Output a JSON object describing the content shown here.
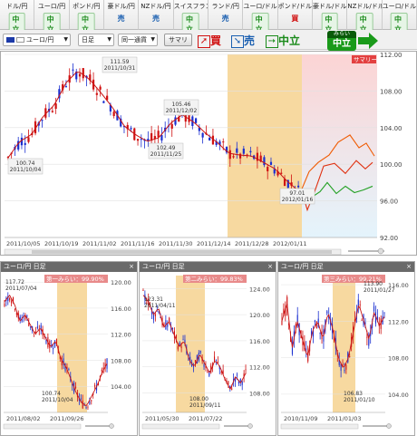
{
  "tabs": [
    {
      "name": "ドル/円",
      "signal": "中立",
      "type": "chu"
    },
    {
      "name": "ユーロ/円",
      "signal": "中立",
      "type": "chu"
    },
    {
      "name": "ポンド/円",
      "signal": "中立",
      "type": "chu"
    },
    {
      "name": "豪ドル/円",
      "signal": "売",
      "type": "uri"
    },
    {
      "name": "NZドル/円",
      "signal": "売",
      "type": "uri"
    },
    {
      "name": "スイスフラン/円",
      "signal": "中立",
      "type": "chu"
    },
    {
      "name": "ランド/円",
      "signal": "売",
      "type": "uri"
    },
    {
      "name": "ユーロ/ドル",
      "signal": "中立",
      "type": "chu"
    },
    {
      "name": "ポンド/ドル",
      "signal": "買",
      "type": "kai"
    },
    {
      "name": "豪ドル/ドル",
      "signal": "中立",
      "type": "chu"
    },
    {
      "name": "NZドル/ドル",
      "signal": "中立",
      "type": "chu"
    },
    {
      "name": "ユーロ/ドル",
      "signal": "中立",
      "type": "chu"
    }
  ],
  "toolbar": {
    "pair": "ユーロ/円",
    "period": "日足",
    "mode": "同一通貨",
    "summary_btn": "サマリ",
    "buy": "買",
    "sell": "売",
    "neutral": "中立",
    "mirai_label": "みらい",
    "mirai_signal": "中立"
  },
  "colors": {
    "up": "#d01010",
    "down": "#1a2fd0",
    "ma": "#c81414",
    "highlight": "#f7d9a0",
    "forecast_bg": "#fbe0e0",
    "forecast_bg2": "#e6f4fb",
    "green": "#22a022",
    "orange": "#f05a00"
  },
  "main": {
    "summary_tag": "サマリー",
    "y_ticks": [
      "112.00",
      "108.00",
      "104.00",
      "100.00",
      "96.00",
      "92.00"
    ],
    "x_ticks": [
      "2011/10/05",
      "2011/10/19",
      "2011/11/02",
      "2011/11/16",
      "2011/11/30",
      "2011/12/14",
      "2011/12/28",
      "2012/01/11"
    ],
    "annotations": [
      {
        "value": "111.59",
        "date": "2011/10/31"
      },
      {
        "value": "105.46",
        "date": "2011/12/02"
      },
      {
        "value": "102.49",
        "date": "2011/11/25"
      },
      {
        "value": "100.74",
        "date": "2011/10/04"
      },
      {
        "value": "97.01",
        "date": "2012/01/16"
      }
    ]
  },
  "panels": [
    {
      "title": "ユーロ/円 日足",
      "mirai": "第一みらい",
      "pct": "99.90%",
      "y_ticks": [
        "120.00",
        "116.00",
        "112.00",
        "108.00",
        "104.00"
      ],
      "x_ticks": [
        "2011/08/02",
        "2011/09/26"
      ],
      "ann": [
        {
          "value": "117.72",
          "date": "2011/07/04"
        },
        {
          "value": "100.74",
          "date": "2011/10/04"
        }
      ]
    },
    {
      "title": "ユーロ/円 日足",
      "mirai": "第二みらい",
      "pct": "99.83%",
      "y_ticks": [
        "124.00",
        "120.00",
        "116.00",
        "112.00",
        "108.00"
      ],
      "x_ticks": [
        "2011/05/30",
        "2011/07/22"
      ],
      "ann": [
        {
          "value": "123.31",
          "date": "2011/04/11"
        },
        {
          "value": "108.00",
          "date": "2011/09/11"
        }
      ]
    },
    {
      "title": "ユーロ/円 日足",
      "mirai": "第三みらい",
      "pct": "99.21%",
      "y_ticks": [
        "116.00",
        "112.00",
        "108.00",
        "104.00"
      ],
      "x_ticks": [
        "2010/11/09",
        "2011/01/03"
      ],
      "ann": [
        {
          "value": "113.90",
          "date": "2011/01/27"
        },
        {
          "value": "106.83",
          "date": "2011/01/10"
        }
      ]
    }
  ]
}
